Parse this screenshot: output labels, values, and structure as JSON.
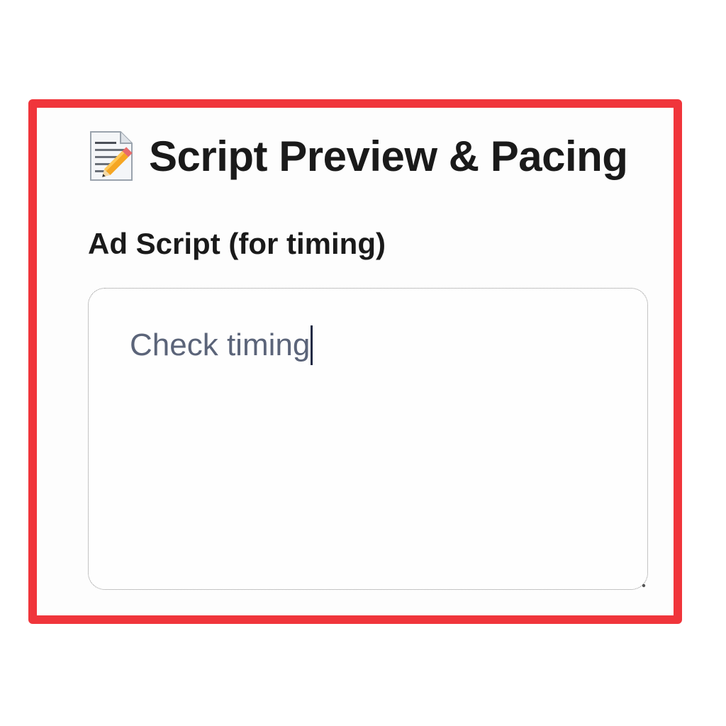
{
  "panel": {
    "title": "Script Preview & Pacing",
    "title_icon": "memo-icon",
    "border_color": "#f0353b"
  },
  "script_field": {
    "label": "Ad Script (for timing)",
    "value": "Check timing",
    "text_color": "#5b6479"
  }
}
